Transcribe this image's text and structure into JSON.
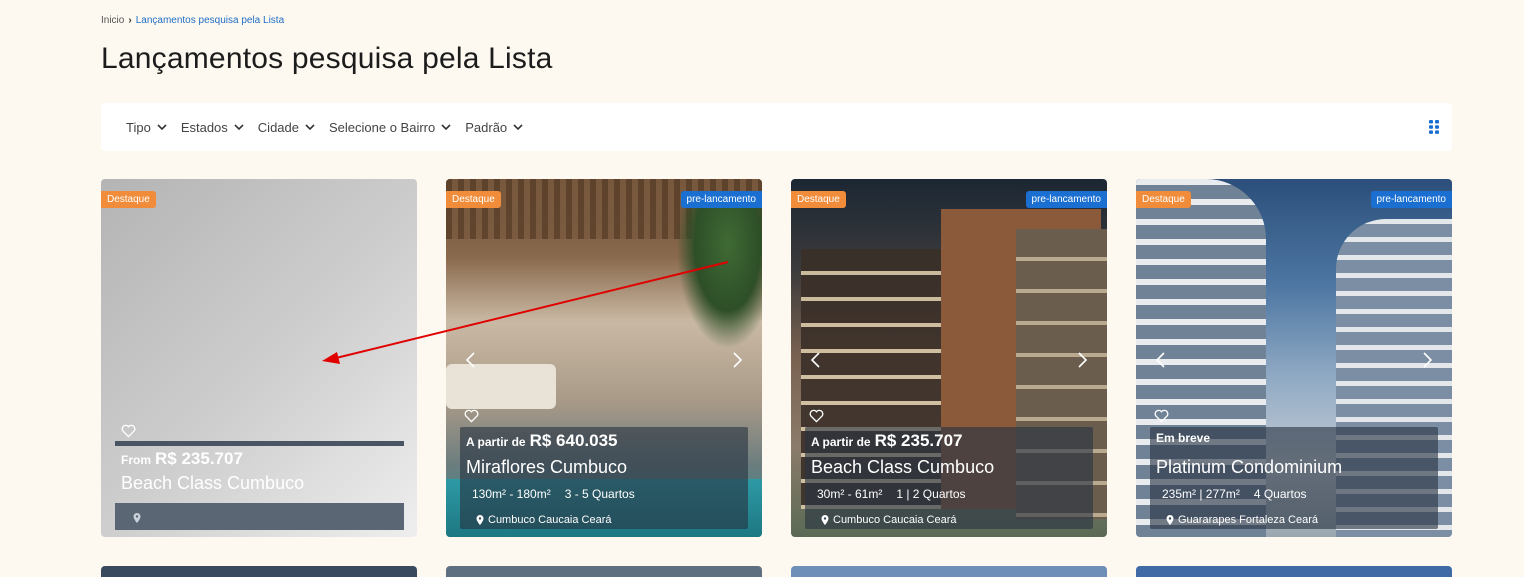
{
  "breadcrumb": {
    "home": "Inicio",
    "current": "Lançamentos pesquisa pela Lista"
  },
  "page": {
    "title": "Lançamentos pesquisa pela Lista"
  },
  "filters": [
    "Tipo",
    "Estados",
    "Cidade",
    "Selecione o Bairro",
    "Padrão"
  ],
  "colors": {
    "accent_orange": "#f08c3a",
    "accent_blue": "#1a6fd1",
    "annotation_arrow": "#e00000"
  },
  "cards": [
    {
      "badge_featured": "Destaque",
      "badge_status": "",
      "price_prefix": "From",
      "price": "R$ 235.707",
      "name": "Beach Class Cumbuco",
      "area": "",
      "rooms": "",
      "location": ""
    },
    {
      "badge_featured": "Destaque",
      "badge_status": "pre-lancamento",
      "price_prefix": "A partir de",
      "price": "R$ 640.035",
      "name": "Miraflores Cumbuco",
      "area": "130m² - 180m²",
      "rooms": "3 - 5 Quartos",
      "location": "Cumbuco Caucaia Ceará"
    },
    {
      "badge_featured": "Destaque",
      "badge_status": "pre-lancamento",
      "price_prefix": "A partir de",
      "price": "R$ 235.707",
      "name": "Beach Class Cumbuco",
      "area": "30m² - 61m²",
      "rooms": "1 | 2 Quartos",
      "location": "Cumbuco Caucaia Ceará"
    },
    {
      "badge_featured": "Destaque",
      "badge_status": "pre-lancamento",
      "price_prefix": "Em breve",
      "price": "",
      "name": "Platinum Condominium",
      "area": "235m² | 277m²",
      "rooms": "4 Quartos",
      "location": "Guararapes Fortaleza Ceará"
    }
  ],
  "icons": {
    "filter_chevron": "chevron-down-icon",
    "grid_toggle": "grid-view-icon",
    "favorite": "heart-icon",
    "location": "map-pin-icon",
    "prev": "chevron-left-icon",
    "next": "chevron-right-icon"
  }
}
